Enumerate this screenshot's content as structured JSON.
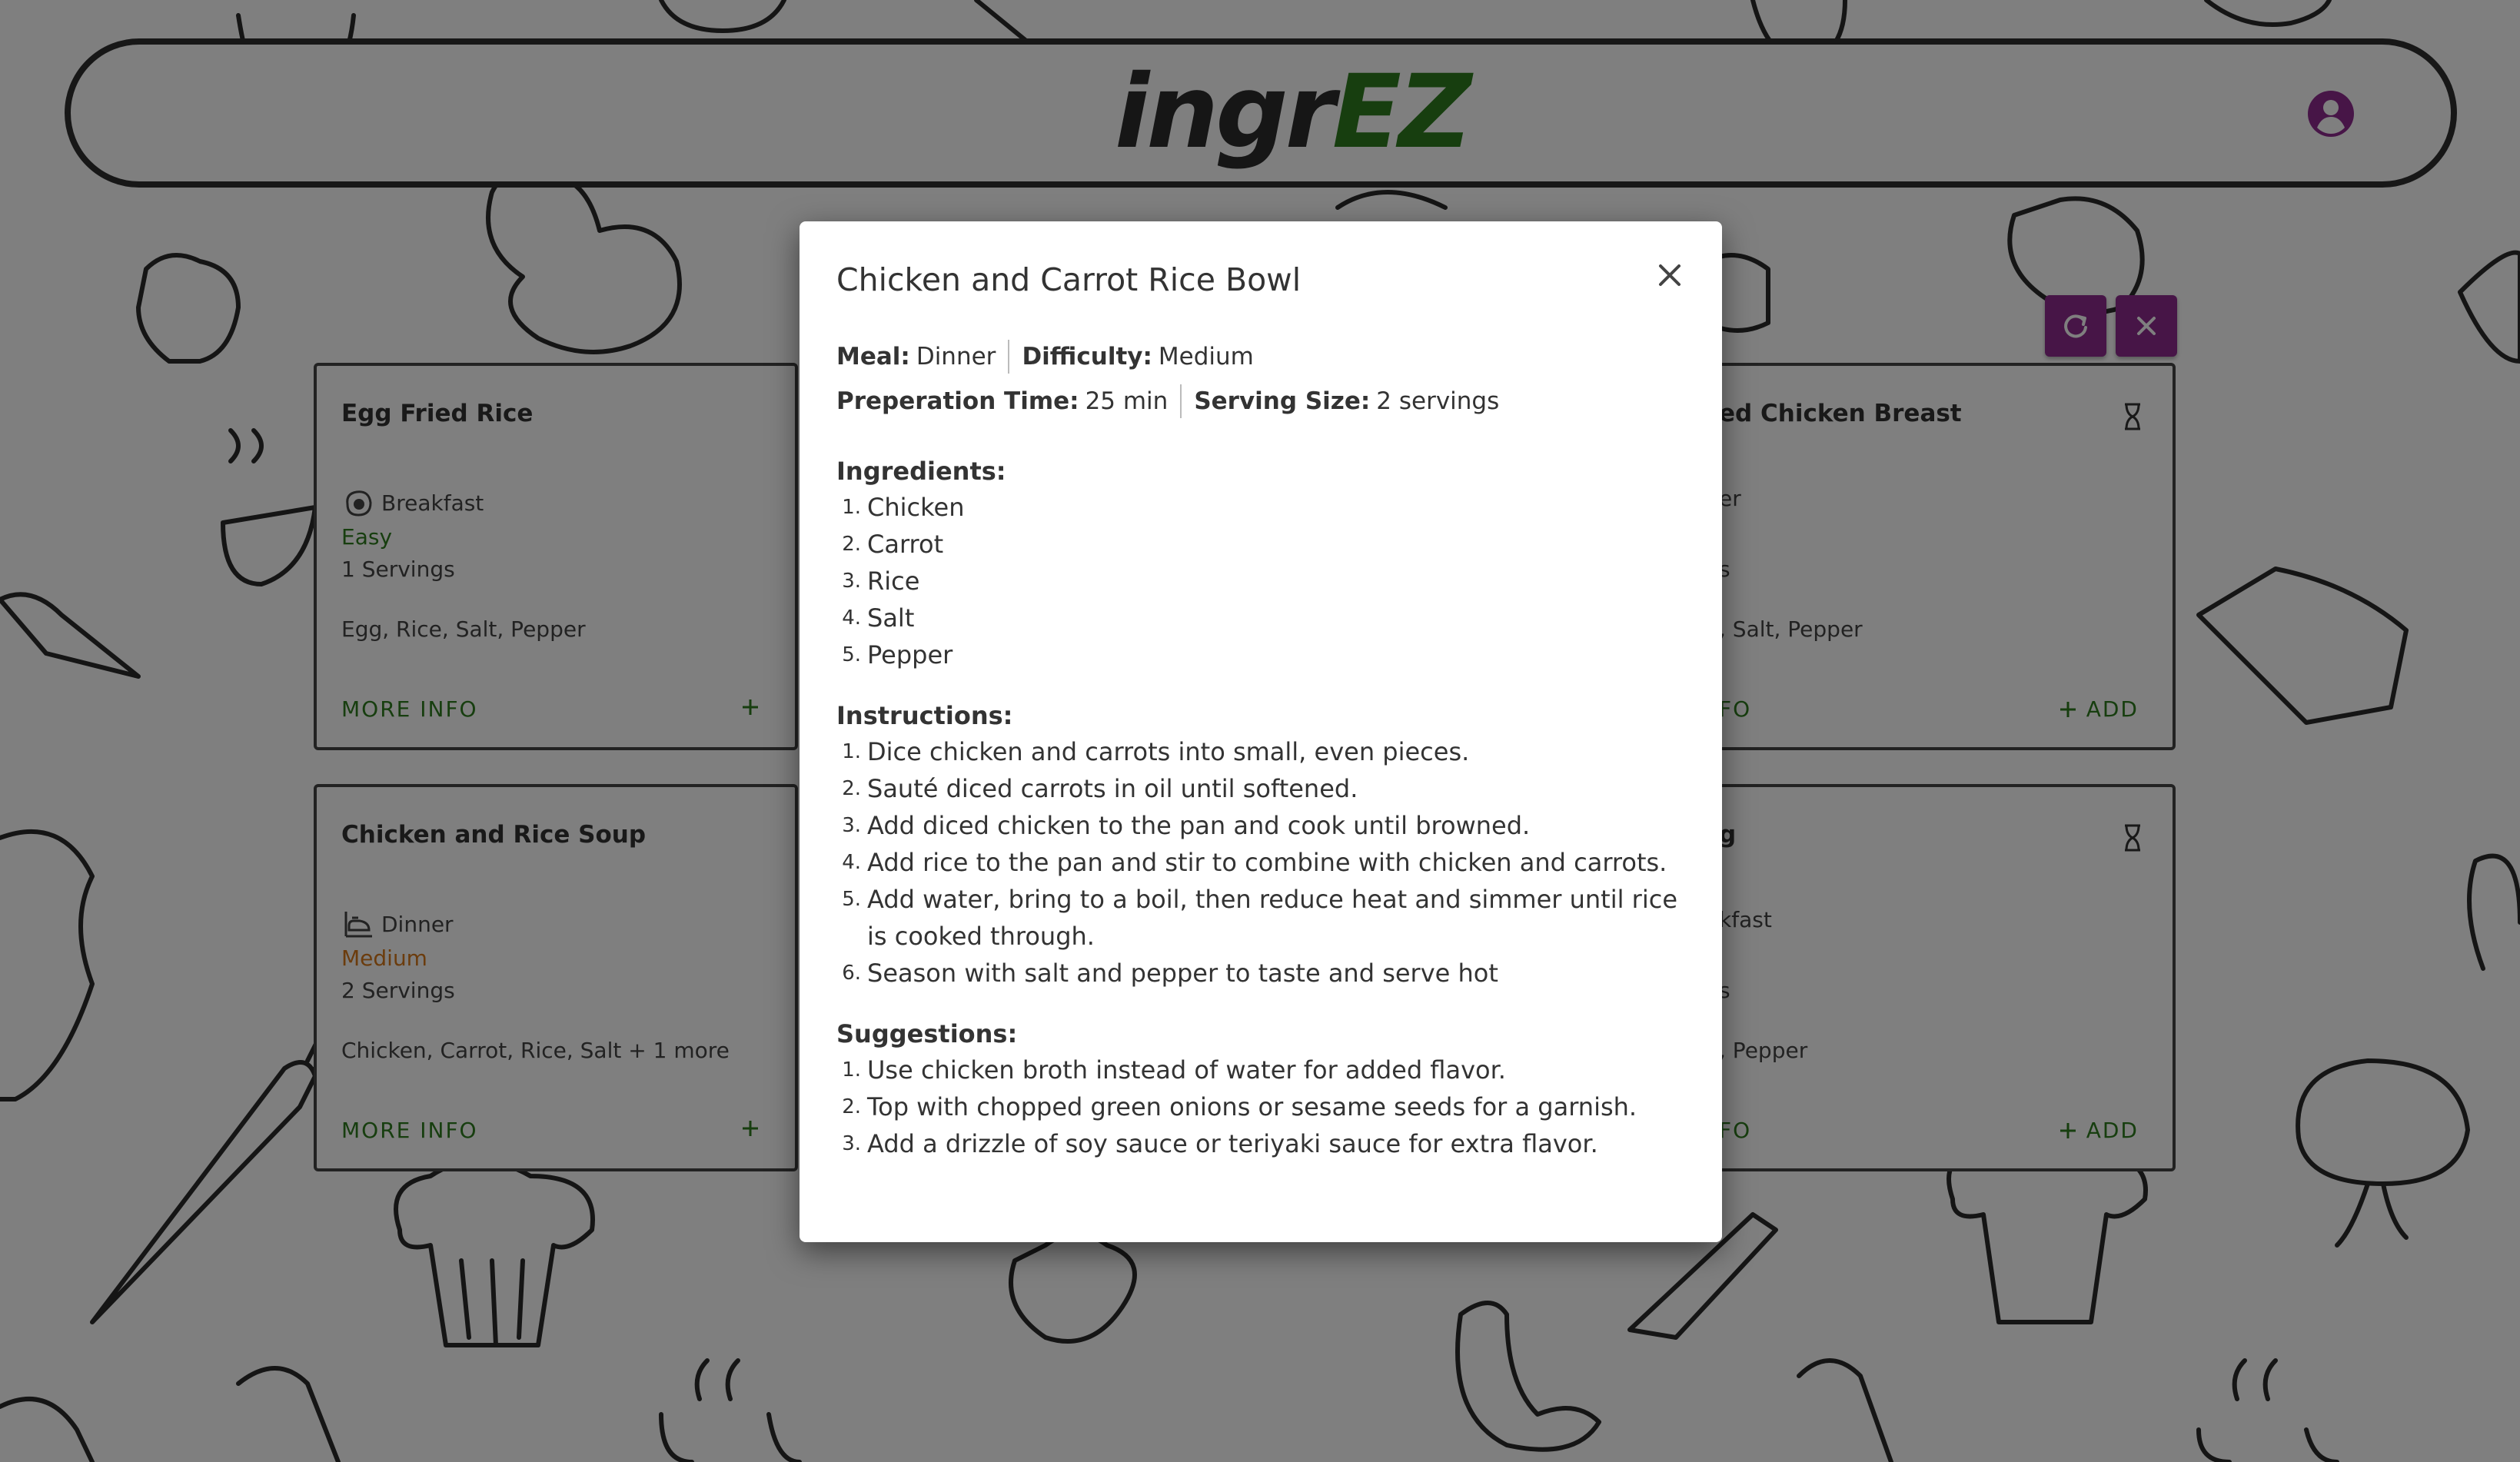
{
  "header": {
    "logo_part1": "ingr",
    "logo_part2": "EZ"
  },
  "cards": [
    {
      "title": "Egg Fried Rice",
      "meal": "Breakfast",
      "difficulty": "Easy",
      "servings": "1 Servings",
      "ingredients": "Egg, Rice, Salt, Pepper",
      "more_info": "MORE INFO",
      "add": ""
    },
    {
      "title": "ed Chicken Breast",
      "meal": "er",
      "difficulty": "",
      "servings": "s",
      "ingredients": ", Salt, Pepper",
      "more_info": "FO",
      "add": "ADD"
    },
    {
      "title": "Chicken and Rice Soup",
      "meal": "Dinner",
      "difficulty": "Medium",
      "servings": "2 Servings",
      "ingredients": "Chicken, Carrot, Rice, Salt + 1 more",
      "more_info": "MORE INFO",
      "add": ""
    },
    {
      "title": "g",
      "meal": "kfast",
      "difficulty": "",
      "servings": "s",
      "ingredients": ", Pepper",
      "more_info": "FO",
      "add": "ADD"
    }
  ],
  "modal": {
    "title": "Chicken and Carrot Rice Bowl",
    "meal_label": "Meal:",
    "meal_value": "Dinner",
    "difficulty_label": "Difficulty:",
    "difficulty_value": "Medium",
    "prep_label": "Preperation Time:",
    "prep_value": "25 min",
    "serving_label": "Serving Size:",
    "serving_value": "2 servings",
    "ingredients_title": "Ingredients:",
    "ingredients": [
      "Chicken",
      "Carrot",
      "Rice",
      "Salt",
      "Pepper"
    ],
    "instructions_title": "Instructions:",
    "instructions": [
      "Dice chicken and carrots into small, even pieces.",
      "Sauté diced carrots in oil until softened.",
      "Add diced chicken to the pan and cook until browned.",
      "Add rice to the pan and stir to combine with chicken and carrots.",
      "Add water, bring to a boil, then reduce heat and simmer until rice is cooked through.",
      "Season with salt and pepper to taste and serve hot"
    ],
    "suggestions_title": "Suggestions:",
    "suggestions": [
      "Use chicken broth instead of water for added flavor.",
      "Top with chopped green onions or sesame seeds for a garnish.",
      "Add a drizzle of soy sauce or teriyaki sauce for extra flavor."
    ]
  },
  "colors": {
    "brand_green": "#2e7d1f",
    "accent_purple": "#8e2a8f",
    "medium_orange": "#d6781a"
  },
  "icons": [
    "user-circle-icon",
    "refresh-icon",
    "close-icon",
    "hourglass-icon",
    "egg-icon",
    "dinner-icon",
    "plus-icon"
  ]
}
